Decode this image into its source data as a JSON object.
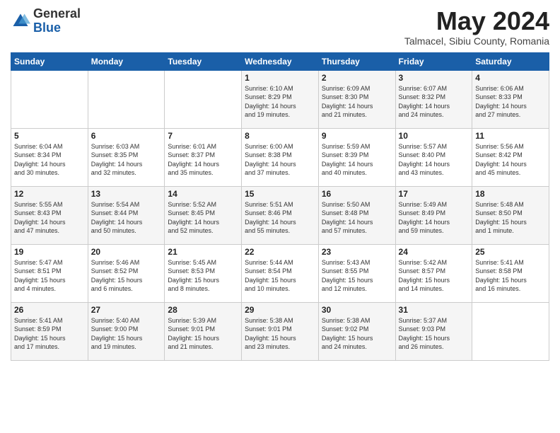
{
  "header": {
    "logo_general": "General",
    "logo_blue": "Blue",
    "month_year": "May 2024",
    "location": "Talmacel, Sibiu County, Romania"
  },
  "days_of_week": [
    "Sunday",
    "Monday",
    "Tuesday",
    "Wednesday",
    "Thursday",
    "Friday",
    "Saturday"
  ],
  "weeks": [
    [
      {
        "day": "",
        "info": ""
      },
      {
        "day": "",
        "info": ""
      },
      {
        "day": "",
        "info": ""
      },
      {
        "day": "1",
        "info": "Sunrise: 6:10 AM\nSunset: 8:29 PM\nDaylight: 14 hours\nand 19 minutes."
      },
      {
        "day": "2",
        "info": "Sunrise: 6:09 AM\nSunset: 8:30 PM\nDaylight: 14 hours\nand 21 minutes."
      },
      {
        "day": "3",
        "info": "Sunrise: 6:07 AM\nSunset: 8:32 PM\nDaylight: 14 hours\nand 24 minutes."
      },
      {
        "day": "4",
        "info": "Sunrise: 6:06 AM\nSunset: 8:33 PM\nDaylight: 14 hours\nand 27 minutes."
      }
    ],
    [
      {
        "day": "5",
        "info": "Sunrise: 6:04 AM\nSunset: 8:34 PM\nDaylight: 14 hours\nand 30 minutes."
      },
      {
        "day": "6",
        "info": "Sunrise: 6:03 AM\nSunset: 8:35 PM\nDaylight: 14 hours\nand 32 minutes."
      },
      {
        "day": "7",
        "info": "Sunrise: 6:01 AM\nSunset: 8:37 PM\nDaylight: 14 hours\nand 35 minutes."
      },
      {
        "day": "8",
        "info": "Sunrise: 6:00 AM\nSunset: 8:38 PM\nDaylight: 14 hours\nand 37 minutes."
      },
      {
        "day": "9",
        "info": "Sunrise: 5:59 AM\nSunset: 8:39 PM\nDaylight: 14 hours\nand 40 minutes."
      },
      {
        "day": "10",
        "info": "Sunrise: 5:57 AM\nSunset: 8:40 PM\nDaylight: 14 hours\nand 43 minutes."
      },
      {
        "day": "11",
        "info": "Sunrise: 5:56 AM\nSunset: 8:42 PM\nDaylight: 14 hours\nand 45 minutes."
      }
    ],
    [
      {
        "day": "12",
        "info": "Sunrise: 5:55 AM\nSunset: 8:43 PM\nDaylight: 14 hours\nand 47 minutes."
      },
      {
        "day": "13",
        "info": "Sunrise: 5:54 AM\nSunset: 8:44 PM\nDaylight: 14 hours\nand 50 minutes."
      },
      {
        "day": "14",
        "info": "Sunrise: 5:52 AM\nSunset: 8:45 PM\nDaylight: 14 hours\nand 52 minutes."
      },
      {
        "day": "15",
        "info": "Sunrise: 5:51 AM\nSunset: 8:46 PM\nDaylight: 14 hours\nand 55 minutes."
      },
      {
        "day": "16",
        "info": "Sunrise: 5:50 AM\nSunset: 8:48 PM\nDaylight: 14 hours\nand 57 minutes."
      },
      {
        "day": "17",
        "info": "Sunrise: 5:49 AM\nSunset: 8:49 PM\nDaylight: 14 hours\nand 59 minutes."
      },
      {
        "day": "18",
        "info": "Sunrise: 5:48 AM\nSunset: 8:50 PM\nDaylight: 15 hours\nand 1 minute."
      }
    ],
    [
      {
        "day": "19",
        "info": "Sunrise: 5:47 AM\nSunset: 8:51 PM\nDaylight: 15 hours\nand 4 minutes."
      },
      {
        "day": "20",
        "info": "Sunrise: 5:46 AM\nSunset: 8:52 PM\nDaylight: 15 hours\nand 6 minutes."
      },
      {
        "day": "21",
        "info": "Sunrise: 5:45 AM\nSunset: 8:53 PM\nDaylight: 15 hours\nand 8 minutes."
      },
      {
        "day": "22",
        "info": "Sunrise: 5:44 AM\nSunset: 8:54 PM\nDaylight: 15 hours\nand 10 minutes."
      },
      {
        "day": "23",
        "info": "Sunrise: 5:43 AM\nSunset: 8:55 PM\nDaylight: 15 hours\nand 12 minutes."
      },
      {
        "day": "24",
        "info": "Sunrise: 5:42 AM\nSunset: 8:57 PM\nDaylight: 15 hours\nand 14 minutes."
      },
      {
        "day": "25",
        "info": "Sunrise: 5:41 AM\nSunset: 8:58 PM\nDaylight: 15 hours\nand 16 minutes."
      }
    ],
    [
      {
        "day": "26",
        "info": "Sunrise: 5:41 AM\nSunset: 8:59 PM\nDaylight: 15 hours\nand 17 minutes."
      },
      {
        "day": "27",
        "info": "Sunrise: 5:40 AM\nSunset: 9:00 PM\nDaylight: 15 hours\nand 19 minutes."
      },
      {
        "day": "28",
        "info": "Sunrise: 5:39 AM\nSunset: 9:01 PM\nDaylight: 15 hours\nand 21 minutes."
      },
      {
        "day": "29",
        "info": "Sunrise: 5:38 AM\nSunset: 9:01 PM\nDaylight: 15 hours\nand 23 minutes."
      },
      {
        "day": "30",
        "info": "Sunrise: 5:38 AM\nSunset: 9:02 PM\nDaylight: 15 hours\nand 24 minutes."
      },
      {
        "day": "31",
        "info": "Sunrise: 5:37 AM\nSunset: 9:03 PM\nDaylight: 15 hours\nand 26 minutes."
      },
      {
        "day": "",
        "info": ""
      }
    ]
  ]
}
